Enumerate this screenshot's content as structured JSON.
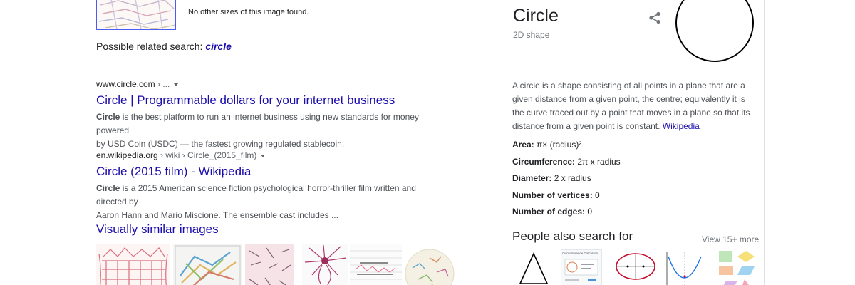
{
  "image_search": {
    "no_other_sizes": "No other sizes of this image found.",
    "related_prefix": "Possible related search: ",
    "related_term": "circle"
  },
  "results": [
    {
      "domain": "www.circle.com",
      "path": " › ...",
      "title": "Circle | Programmable dollars for your internet business",
      "snippet_bold": "Circle",
      "snippet_line1_rest": " is the best platform to run an internet business using new standards for money powered",
      "snippet_line2": "by USD Coin (USDC) — the fastest growing regulated stablecoin."
    },
    {
      "domain": "en.wikipedia.org",
      "path": " › wiki › Circle_(2015_film)",
      "title": "Circle (2015 film) - Wikipedia",
      "snippet_bold": "Circle",
      "snippet_line1_rest": " is a 2015 American science fiction psychological horror-thriller film written and directed by",
      "snippet_line2": "Aaron Hann and Mario Miscione. The ensemble cast includes ..."
    }
  ],
  "visually_similar": {
    "title": "Visually similar images"
  },
  "knowledge_panel": {
    "title": "Circle",
    "subtitle": "2D shape",
    "description": "A circle is a shape consisting of all points in a plane that are a given distance from a given point, the centre; equivalently it is the curve traced out by a point that moves in a plane so that its distance from a given point is constant. ",
    "source_link": "Wikipedia",
    "facts": [
      {
        "label": "Area:",
        "value": " π× (radius)²"
      },
      {
        "label": "Circumference:",
        "value": " 2π x radius"
      },
      {
        "label": "Diameter:",
        "value": " 2 x radius"
      },
      {
        "label": "Number of vertices:",
        "value": " 0"
      },
      {
        "label": "Number of edges:",
        "value": " 0"
      }
    ],
    "people_also_search": {
      "title": "People also search for",
      "more": "View 15+ more",
      "thumb2_caption": "Circumference Calculator"
    }
  },
  "colors": {
    "link": "#1a0dab",
    "text": "#202124",
    "snippet": "#4d5156",
    "muted": "#70757a",
    "border": "#dfe1e5"
  }
}
